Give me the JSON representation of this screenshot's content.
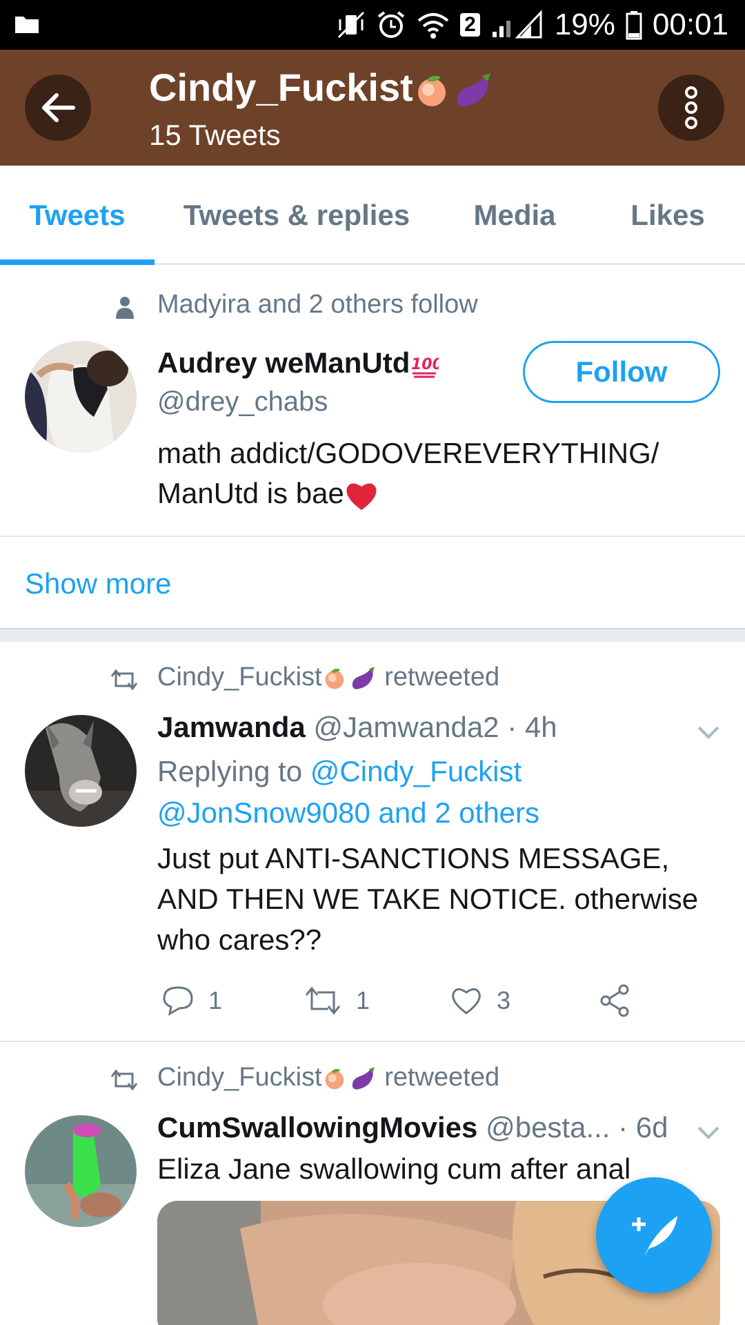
{
  "status_bar": {
    "battery_percent": "19%",
    "time": "00:01",
    "sim_badge": "2"
  },
  "header": {
    "title": "Cindy_Fuckist",
    "subtitle": "15 Tweets",
    "back_icon": "arrow-left-icon",
    "menu_icon": "more-vertical-icon"
  },
  "tabs": [
    {
      "label": "Tweets",
      "active": true
    },
    {
      "label": "Tweets & replies",
      "active": false
    },
    {
      "label": "Media",
      "active": false
    },
    {
      "label": "Likes",
      "active": false
    }
  ],
  "suggestion": {
    "followed_by": "Madyira and 2 others follow",
    "name": "Audrey weManUtd",
    "handle": "@drey_chabs",
    "bio_line1": "math addict/GODOVEREVERYTHING/",
    "bio_line2": "ManUtd is bae",
    "follow_label": "Follow",
    "show_more_label": "Show more"
  },
  "tweets": [
    {
      "retweeted_by": "Cindy_Fuckist",
      "retweeted_label": "retweeted",
      "name": "Jamwanda",
      "handle": "@Jamwanda2",
      "time": "· 4h",
      "replying_label": "Replying to",
      "replying_to_1": "@Cindy_Fuckist",
      "replying_to_2": "@JonSnow9080 and 2 others",
      "text": "Just put ANTI-SANCTIONS MESSAGE, AND THEN WE TAKE NOTICE. otherwise who cares??",
      "replies": "1",
      "retweets": "1",
      "likes": "3"
    },
    {
      "retweeted_by": "Cindy_Fuckist",
      "retweeted_label": "retweeted",
      "name": "CumSwallowingMovies",
      "handle": "@besta...",
      "time": "· 6d",
      "text": "Eliza Jane swallowing cum after anal"
    }
  ],
  "colors": {
    "header_bg": "#6e4228",
    "accent": "#1da1f2",
    "muted": "#657786"
  }
}
